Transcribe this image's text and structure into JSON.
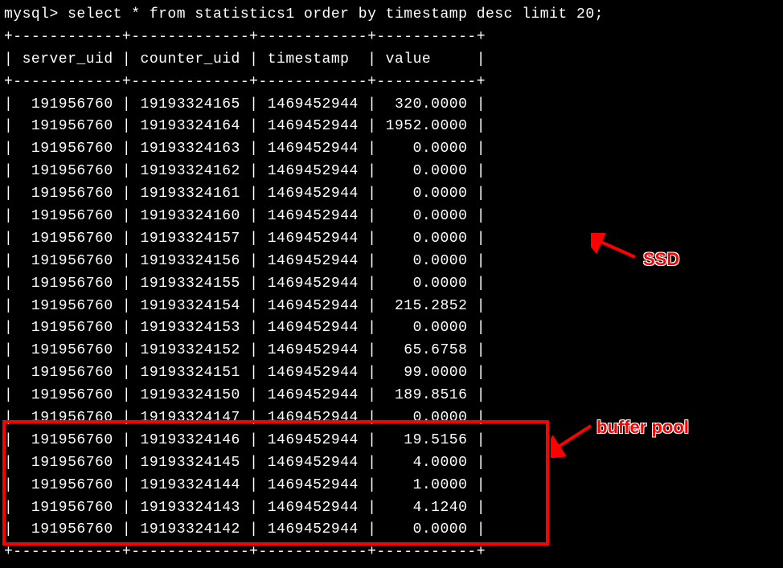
{
  "query": "mysql> select * from statistics1 order by timestamp desc limit 20;",
  "headerBorder": "+------------+-------------+------------+-----------+",
  "columns": [
    "server_uid",
    "counter_uid",
    "timestamp",
    "value"
  ],
  "rows": [
    {
      "server_uid": "191956760",
      "counter_uid": "19193324165",
      "timestamp": "1469452944",
      "value": "320.0000"
    },
    {
      "server_uid": "191956760",
      "counter_uid": "19193324164",
      "timestamp": "1469452944",
      "value": "1952.0000"
    },
    {
      "server_uid": "191956760",
      "counter_uid": "19193324163",
      "timestamp": "1469452944",
      "value": "0.0000"
    },
    {
      "server_uid": "191956760",
      "counter_uid": "19193324162",
      "timestamp": "1469452944",
      "value": "0.0000"
    },
    {
      "server_uid": "191956760",
      "counter_uid": "19193324161",
      "timestamp": "1469452944",
      "value": "0.0000"
    },
    {
      "server_uid": "191956760",
      "counter_uid": "19193324160",
      "timestamp": "1469452944",
      "value": "0.0000"
    },
    {
      "server_uid": "191956760",
      "counter_uid": "19193324157",
      "timestamp": "1469452944",
      "value": "0.0000"
    },
    {
      "server_uid": "191956760",
      "counter_uid": "19193324156",
      "timestamp": "1469452944",
      "value": "0.0000"
    },
    {
      "server_uid": "191956760",
      "counter_uid": "19193324155",
      "timestamp": "1469452944",
      "value": "0.0000"
    },
    {
      "server_uid": "191956760",
      "counter_uid": "19193324154",
      "timestamp": "1469452944",
      "value": "215.2852"
    },
    {
      "server_uid": "191956760",
      "counter_uid": "19193324153",
      "timestamp": "1469452944",
      "value": "0.0000"
    },
    {
      "server_uid": "191956760",
      "counter_uid": "19193324152",
      "timestamp": "1469452944",
      "value": "65.6758"
    },
    {
      "server_uid": "191956760",
      "counter_uid": "19193324151",
      "timestamp": "1469452944",
      "value": "99.0000"
    },
    {
      "server_uid": "191956760",
      "counter_uid": "19193324150",
      "timestamp": "1469452944",
      "value": "189.8516"
    },
    {
      "server_uid": "191956760",
      "counter_uid": "19193324147",
      "timestamp": "1469452944",
      "value": "0.0000"
    },
    {
      "server_uid": "191956760",
      "counter_uid": "19193324146",
      "timestamp": "1469452944",
      "value": "19.5156"
    },
    {
      "server_uid": "191956760",
      "counter_uid": "19193324145",
      "timestamp": "1469452944",
      "value": "4.0000"
    },
    {
      "server_uid": "191956760",
      "counter_uid": "19193324144",
      "timestamp": "1469452944",
      "value": "1.0000"
    },
    {
      "server_uid": "191956760",
      "counter_uid": "19193324143",
      "timestamp": "1469452944",
      "value": "4.1240"
    },
    {
      "server_uid": "191956760",
      "counter_uid": "19193324142",
      "timestamp": "1469452944",
      "value": "0.0000"
    }
  ],
  "annotations": {
    "ssd": "SSD",
    "bufferpool": "buffer pool"
  },
  "colWidths": {
    "server_uid": 12,
    "counter_uid": 13,
    "timestamp": 12,
    "value": 11
  }
}
